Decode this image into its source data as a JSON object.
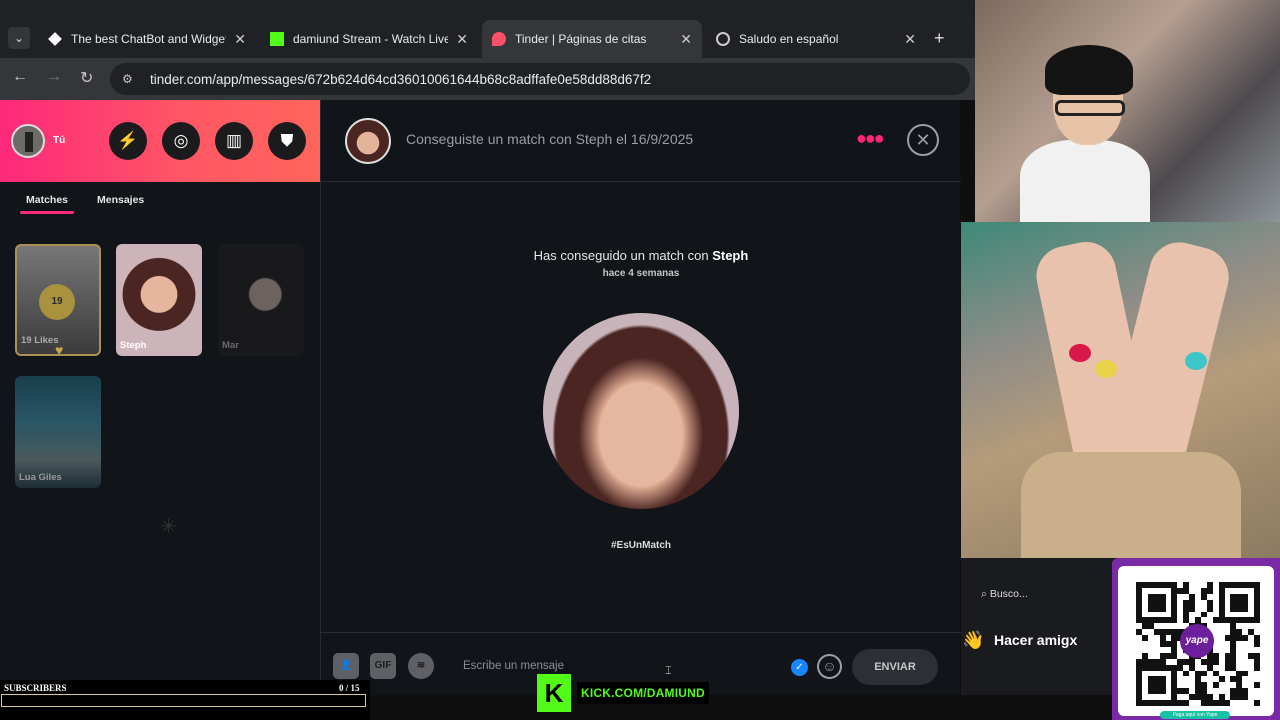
{
  "browser": {
    "tabs": [
      {
        "title": "The best ChatBot and Widgets",
        "icon": "diamond-icon"
      },
      {
        "title": "damiund Stream - Watch Live o",
        "icon": "kick-icon"
      },
      {
        "title": "Tinder | Páginas de citas",
        "icon": "tinder-flame-icon",
        "active": true
      },
      {
        "title": "Saludo en español",
        "icon": "openai-icon"
      }
    ],
    "url": "tinder.com/app/messages/672b624d64cd36010061644b68c8adffafe0e58dd88d67f2"
  },
  "sidebar": {
    "me_label": "Tú",
    "tabs": {
      "matches": "Matches",
      "messages": "Mensajes"
    },
    "likes": {
      "count": "19",
      "label": "19 Likes"
    },
    "matches": [
      {
        "name": "Steph"
      },
      {
        "name": "Mar"
      },
      {
        "name": "Lua Giles"
      }
    ]
  },
  "chat": {
    "header": "Conseguiste un match con Steph el 16/9/2025",
    "headline_prefix": "Has conseguido un match con",
    "headline_name": "Steph",
    "ago": "hace 4 semanas",
    "tagline": "#EsUnMatch",
    "composer": {
      "placeholder": "Escribe un mensaje",
      "gif_label": "GIF",
      "send_label": "ENVIAR"
    }
  },
  "overlay": {
    "chat_search": "Busco...",
    "chat_message": "Hacer amigx",
    "subscribers_label": "SUBSCRIBERS",
    "subscribers_count": "0  / 15",
    "subscribers_progress": 0.0,
    "kick_url": "KICK.COM/DAMIUND",
    "kick_logo": "K",
    "yape_label": "yape",
    "yape_note": "Paga aquí con Yape"
  },
  "colors": {
    "tinder_pink": "#fd297b",
    "tinder_orange": "#ff655b",
    "kick_green": "#53fc18",
    "qr_purple": "#7b2aa6"
  }
}
